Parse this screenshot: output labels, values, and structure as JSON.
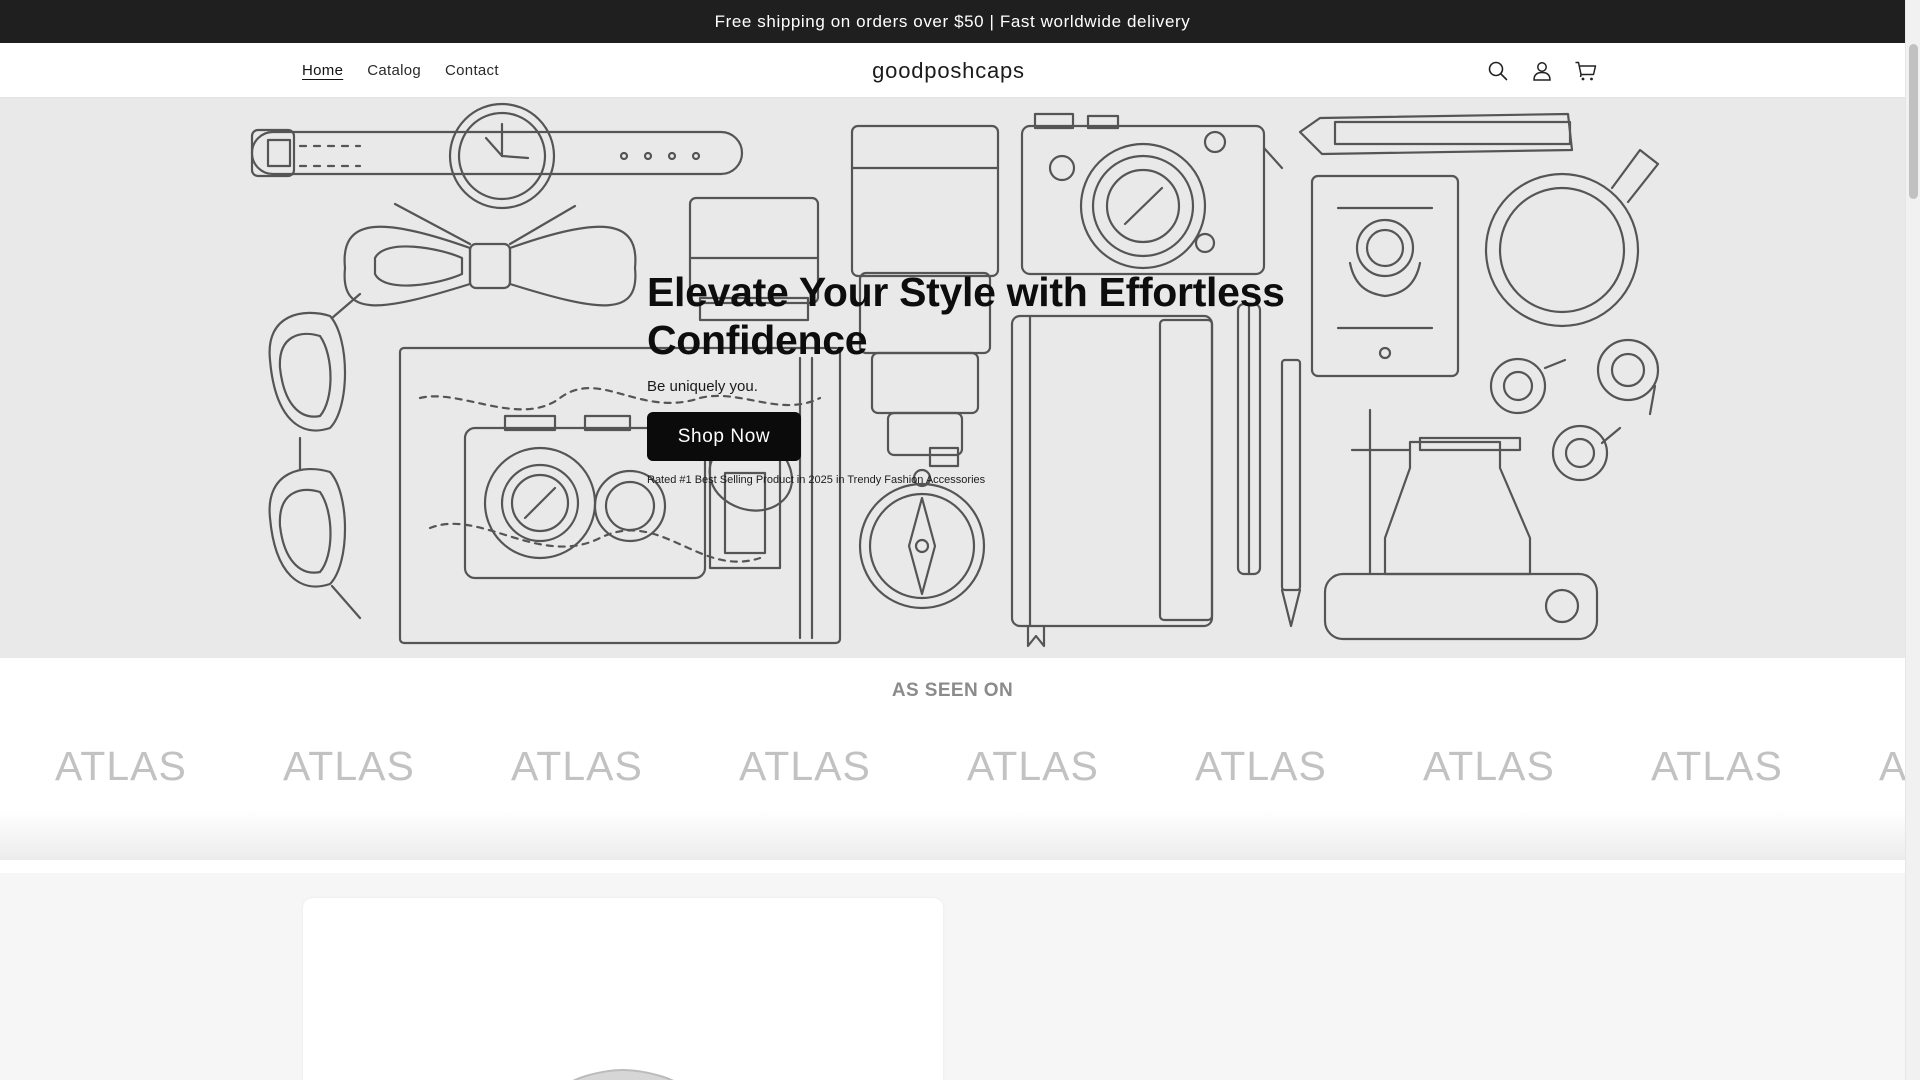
{
  "announcement": {
    "text": "Free shipping on orders over $50 | Fast worldwide delivery"
  },
  "header": {
    "nav": [
      {
        "label": "Home",
        "active": true
      },
      {
        "label": "Catalog",
        "active": false
      },
      {
        "label": "Contact",
        "active": false
      }
    ],
    "logo": "goodposhcaps",
    "icons": [
      "search-icon",
      "account-icon",
      "cart-icon"
    ]
  },
  "hero": {
    "title": "Elevate Your Style with Effortless Confidence",
    "subtitle": "Be uniquely you.",
    "button_label": "Shop Now",
    "rating_text": "Rated #1 Best Selling Product in 2025 in Trendy Fashion Accessories"
  },
  "seen_on": {
    "title": "AS SEEN ON",
    "brands": [
      "ATLAS",
      "ATLAS",
      "ATLAS",
      "ATLAS",
      "ATLAS",
      "ATLAS",
      "ATLAS",
      "ATLAS",
      "ATLAS"
    ]
  },
  "colors": {
    "announcement_bg": "#1f1f1f",
    "hero_bg": "#e9e9e9",
    "button_bg": "#0b0b0b",
    "brand_text": "#c2c2c2"
  }
}
